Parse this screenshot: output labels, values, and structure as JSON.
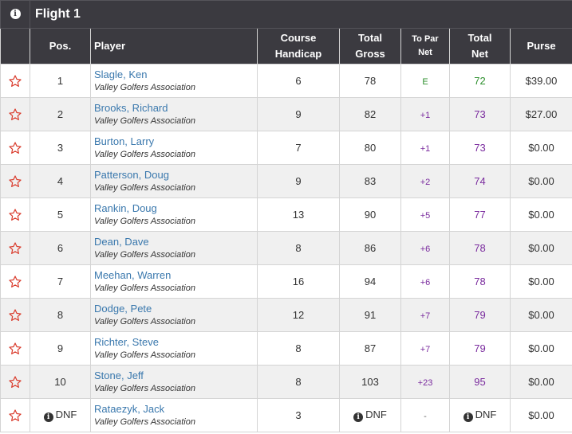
{
  "flight": {
    "info_icon": "info-icon",
    "title": "Flight 1"
  },
  "headers": {
    "pos": "Pos.",
    "player": "Player",
    "course_handicap": [
      "Course",
      "Handicap"
    ],
    "total_gross": [
      "Total",
      "Gross"
    ],
    "to_par_net": [
      "To Par",
      "Net"
    ],
    "total_net": [
      "Total",
      "Net"
    ],
    "purse": "Purse"
  },
  "colors": {
    "header_bg": "#3b3a40",
    "player_link": "#3a78ad",
    "over_par": "#7a2b9e",
    "even_par": "#2d8f2d",
    "star": "#d93a2b"
  },
  "rows": [
    {
      "pos": "1",
      "name": "Slagle, Ken",
      "assoc": "Valley Golfers Association",
      "handicap": "6",
      "gross": "78",
      "to_par": "E",
      "net": "72",
      "purse": "$39.00"
    },
    {
      "pos": "2",
      "name": "Brooks, Richard",
      "assoc": "Valley Golfers Association",
      "handicap": "9",
      "gross": "82",
      "to_par": "+1",
      "net": "73",
      "purse": "$27.00"
    },
    {
      "pos": "3",
      "name": "Burton, Larry",
      "assoc": "Valley Golfers Association",
      "handicap": "7",
      "gross": "80",
      "to_par": "+1",
      "net": "73",
      "purse": "$0.00"
    },
    {
      "pos": "4",
      "name": "Patterson, Doug",
      "assoc": "Valley Golfers Association",
      "handicap": "9",
      "gross": "83",
      "to_par": "+2",
      "net": "74",
      "purse": "$0.00"
    },
    {
      "pos": "5",
      "name": "Rankin, Doug",
      "assoc": "Valley Golfers Association",
      "handicap": "13",
      "gross": "90",
      "to_par": "+5",
      "net": "77",
      "purse": "$0.00"
    },
    {
      "pos": "6",
      "name": "Dean, Dave",
      "assoc": "Valley Golfers Association",
      "handicap": "8",
      "gross": "86",
      "to_par": "+6",
      "net": "78",
      "purse": "$0.00"
    },
    {
      "pos": "7",
      "name": "Meehan, Warren",
      "assoc": "Valley Golfers Association",
      "handicap": "16",
      "gross": "94",
      "to_par": "+6",
      "net": "78",
      "purse": "$0.00"
    },
    {
      "pos": "8",
      "name": "Dodge, Pete",
      "assoc": "Valley Golfers Association",
      "handicap": "12",
      "gross": "91",
      "to_par": "+7",
      "net": "79",
      "purse": "$0.00"
    },
    {
      "pos": "9",
      "name": "Richter, Steve",
      "assoc": "Valley Golfers Association",
      "handicap": "8",
      "gross": "87",
      "to_par": "+7",
      "net": "79",
      "purse": "$0.00"
    },
    {
      "pos": "10",
      "name": "Stone, Jeff",
      "assoc": "Valley Golfers Association",
      "handicap": "8",
      "gross": "103",
      "to_par": "+23",
      "net": "95",
      "purse": "$0.00"
    },
    {
      "pos": "DNF",
      "name": "Rataezyk, Jack",
      "assoc": "Valley Golfers Association",
      "handicap": "3",
      "gross": "DNF",
      "to_par": "-",
      "net": "DNF",
      "purse": "$0.00",
      "dnf": true
    }
  ]
}
